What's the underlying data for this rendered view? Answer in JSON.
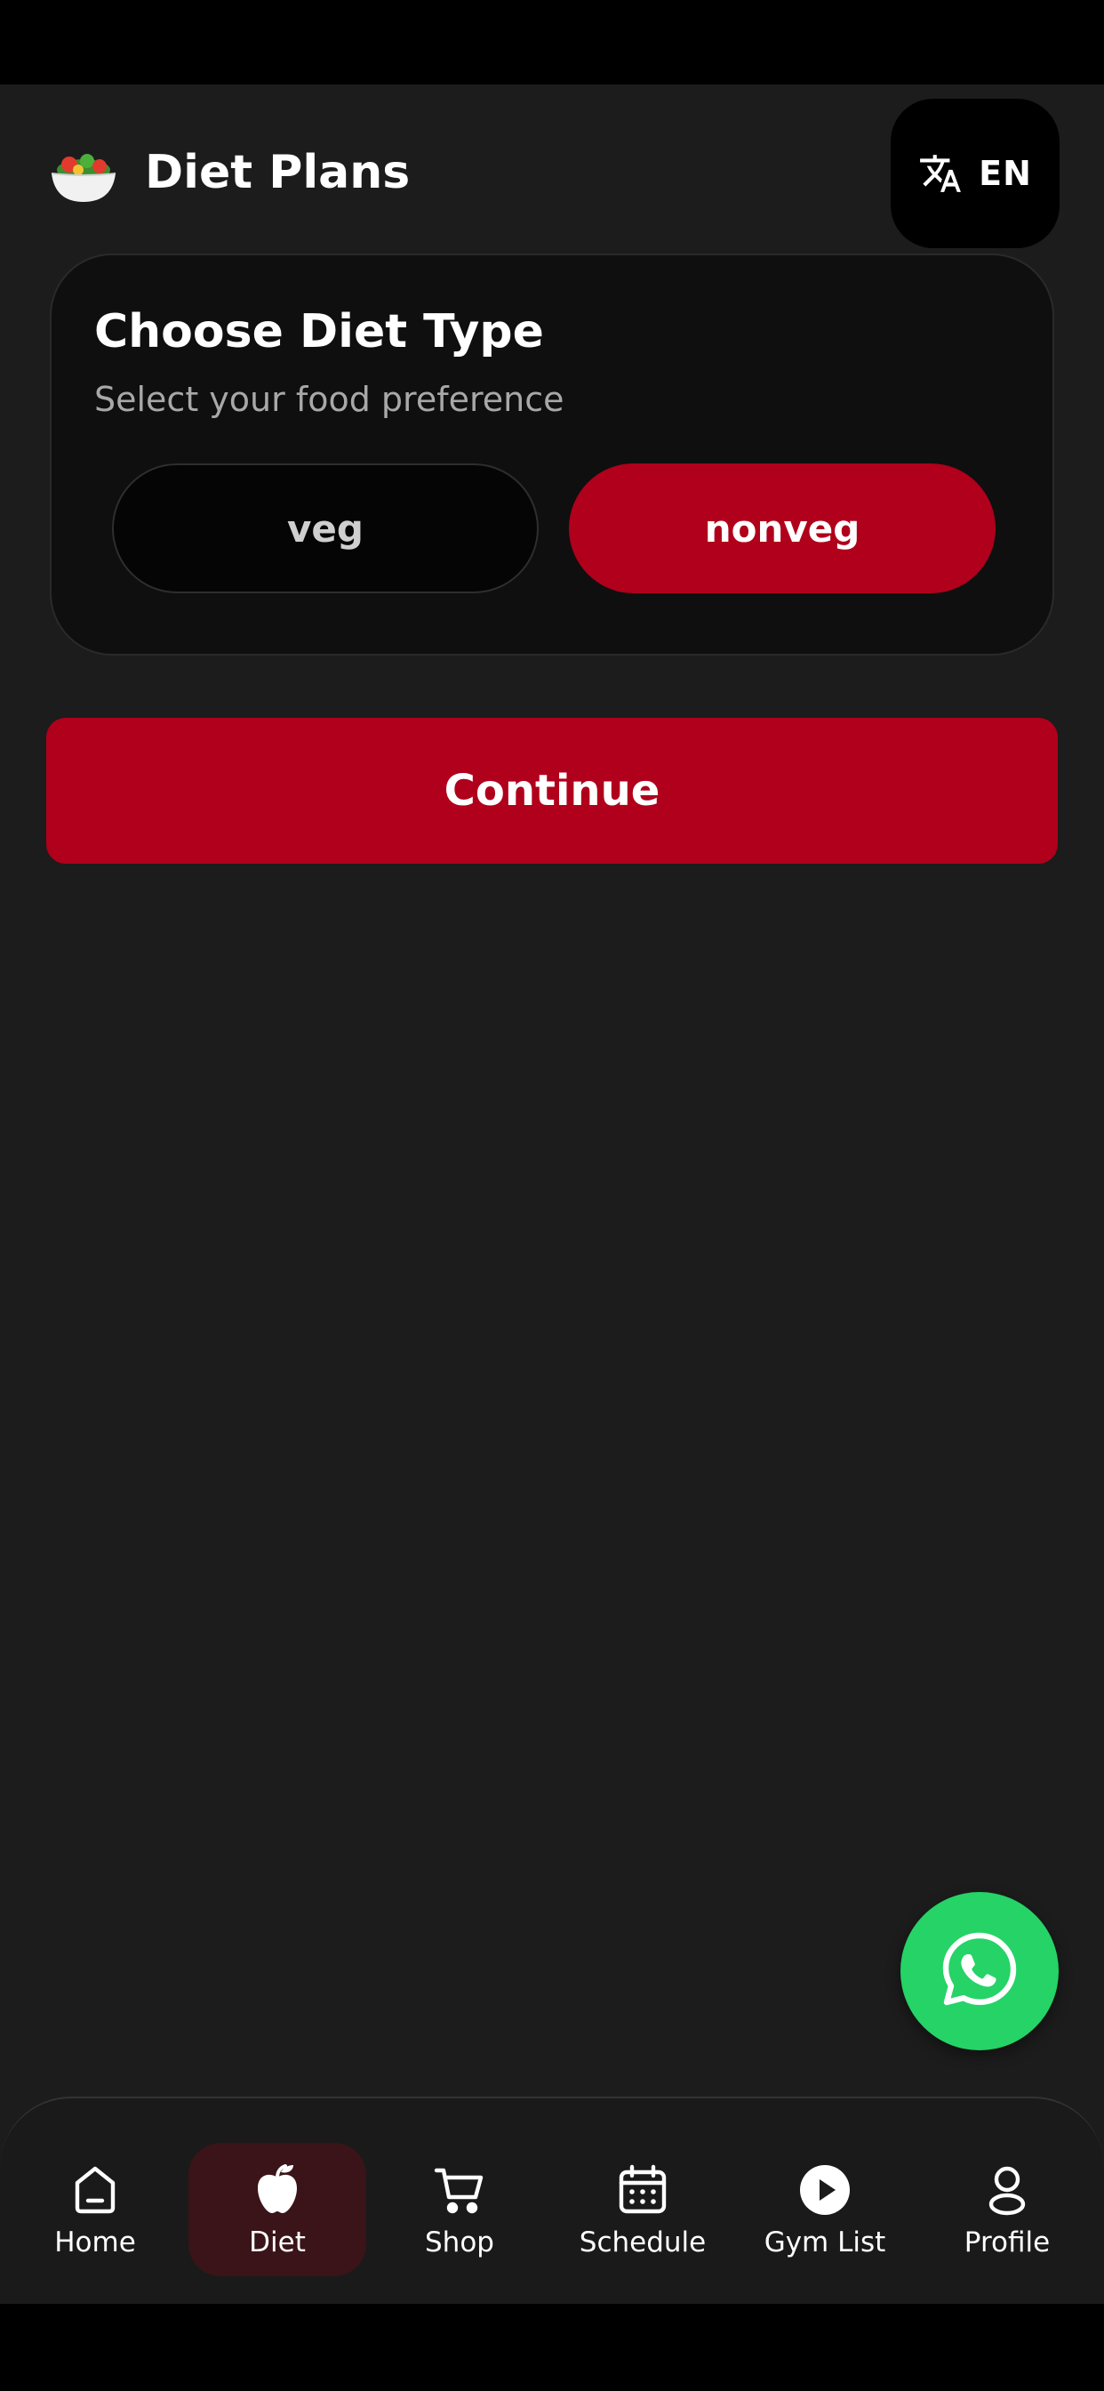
{
  "header": {
    "title": "Diet Plans",
    "logo_icon": "salad-bowl-icon",
    "language_icon": "translate-icon",
    "language_code": "EN"
  },
  "card": {
    "title": "Choose Diet Type",
    "subtitle": "Select your food preference",
    "options": [
      {
        "label": "veg",
        "selected": false
      },
      {
        "label": "nonveg",
        "selected": true
      }
    ]
  },
  "continue_label": "Continue",
  "fab_icon": "whatsapp-icon",
  "nav": {
    "items": [
      {
        "label": "Home",
        "icon": "home-icon",
        "active": false
      },
      {
        "label": "Diet",
        "icon": "apple-icon",
        "active": true
      },
      {
        "label": "Shop",
        "icon": "cart-icon",
        "active": false
      },
      {
        "label": "Schedule",
        "icon": "calendar-icon",
        "active": false
      },
      {
        "label": "Gym List",
        "icon": "play-icon",
        "active": false
      },
      {
        "label": "Profile",
        "icon": "user-icon",
        "active": false
      }
    ]
  },
  "colors": {
    "accent": "#b0001c",
    "background": "#1c1c1c",
    "card": "#0f0f0f",
    "whatsapp": "#25d366",
    "nav_active_bg": "#3a1418"
  }
}
